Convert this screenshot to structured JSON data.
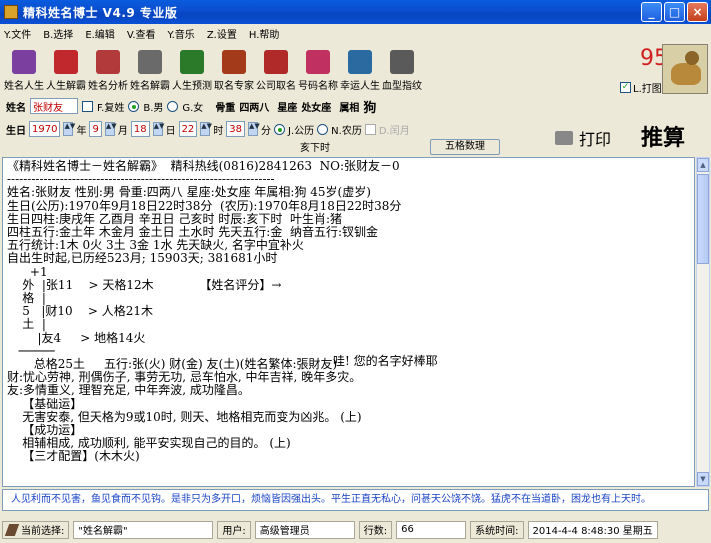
{
  "window": {
    "title": "精科姓名博士  V4.9 专业版",
    "buttons": [
      "_",
      "□",
      "×"
    ]
  },
  "menu": [
    "Y.文件",
    "B.选择",
    "E.编辑",
    "V.查看",
    "Y.音乐",
    "Z.设置",
    "H.帮助"
  ],
  "toolbar": {
    "items": [
      {
        "label": "姓名人生",
        "icon": "books-icon",
        "color": "#7b3fa0"
      },
      {
        "label": "人生解霸",
        "icon": "stack-icon",
        "color": "#c0282e"
      },
      {
        "label": "姓名分析",
        "icon": "book-icon",
        "color": "#b33a3a"
      },
      {
        "label": "姓名解霸",
        "icon": "folder-icon",
        "color": "#6a6a6a"
      },
      {
        "label": "人生预测",
        "icon": "books-icon",
        "color": "#2a7a2a"
      },
      {
        "label": "取名专家",
        "icon": "books-icon",
        "color": "#a33a1a"
      },
      {
        "label": "公司取名",
        "icon": "stack-icon",
        "color": "#b02a2a"
      },
      {
        "label": "号码名称",
        "icon": "book-icon",
        "color": "#c03060"
      },
      {
        "label": "幸运人生",
        "icon": "book-icon",
        "color": "#2a6aa0"
      },
      {
        "label": "血型指纹",
        "icon": "binder-icon",
        "color": "#5a5a5a"
      }
    ],
    "count": "95",
    "print_label": "L.打图",
    "print_checked": true,
    "zodiac_image": "dog-image"
  },
  "form": {
    "name_label": "姓名",
    "name_value": "张财友",
    "fuxing_label": "F.复姓",
    "male_label": "B.男",
    "female_label": "G.女",
    "gender": "male",
    "bone_weight_label": "骨重",
    "bone_weight_value": "四两八",
    "star_label": "星座",
    "star_value": "处女座",
    "zodiac_label": "属相",
    "zodiac_value": "狗",
    "birth_label": "生日",
    "year": "1970",
    "year_unit": "年",
    "month": "9",
    "month_unit": "月",
    "day": "18",
    "day_unit": "日",
    "hour": "22",
    "hour_unit": "时",
    "minute": "38",
    "minute_unit": "分",
    "solar_label": "J.公历",
    "lunar_label": "N.农历",
    "leap_label": "D.闰月",
    "calendar": "solar",
    "shichen": "亥下时",
    "wuge_button": "五格数理",
    "print_button": "打印",
    "calc_button": "推算"
  },
  "content": {
    "lines": [
      "《精科姓名博士－姓名解霸》  精科热线(0816)2841263  NO:张财友－0",
      "------------------------------------------------------------------",
      "姓名:张财友 性别:男 骨重:四两八 星座:处女座 年属相:狗 45岁(虚岁)",
      "生日(公历):1970年9月18日22时38分  (农历):1970年8月18日22时38分",
      "生日四柱:庚戌年 乙酉月 辛丑日 己亥时 时辰:亥下时  叶生肖:猪",
      "四柱五行:金土年 木金月 金土日 土水时 先天五行:金  纳音五行:钗钏金",
      "五行统计:1木 0火 3土 3金 1水 先天缺火, 名字中宜补火",
      "自出生时起,已历经523月; 15903天; 381681小时",
      "      +1",
      "    外  |张11    > 天格12木            【姓名评分】→",
      "    格  |",
      "    5   |财10    > 人格21木",
      "    土  |",
      "        |友4     > 地格14火",
      "   ─────",
      "       总格25土     五行:张(火) 财(金) 友(土)(姓名繁体:張財友)",
      "财:忧心劳神, 刑偶伤子, 事劳无功, 忌车怕水, 中年吉祥, 晚年多灾。",
      "友:多情重义, 理智充足, 中年奔波, 成功隆昌。",
      "    【基础运】",
      "    无害安泰, 但天格为9或10时, 则天、地格相克而变为凶兆。 (上)",
      "    【成功运】",
      "    相辅相成, 成功顺利, 能平安实现自己的目的。 (上)",
      "    【三才配置】(木木火)"
    ],
    "score_callout": "哇! 您的名字好棒耶"
  },
  "ticker": "人见利而不见害，鱼见食而不见钩。是非只为多开口，烦恼皆因强出头。平生正直无私心，问甚天公饶不饶。猛虎不在当道卧，困龙也有上天时。",
  "status": {
    "current_label": "当前选择:",
    "current_value": "\"姓名解霸\"",
    "user_label": "用户:",
    "user_value": "高级管理员",
    "rows_label": "行数:",
    "rows_value": "66",
    "time_label": "系统时间:",
    "time_value": "2014-4-4 8:48:30 星期五"
  }
}
